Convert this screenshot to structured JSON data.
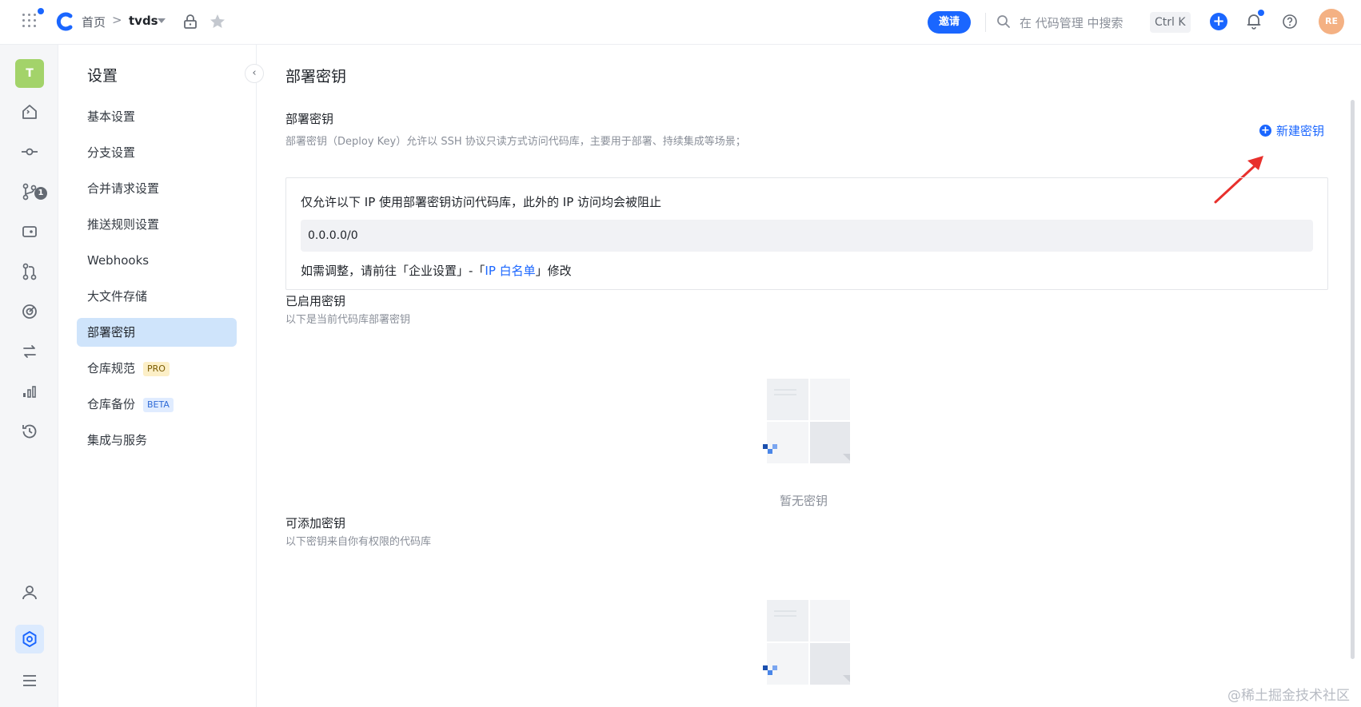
{
  "topbar": {
    "home": "首页",
    "sep": ">",
    "repo": "tvds",
    "invite": "邀请",
    "search_placeholder": "在 代码管理 中搜索",
    "shortcut": "Ctrl K",
    "avatar": "RE"
  },
  "rail": {
    "avatar": "T",
    "badge": "1",
    "icons": [
      "home-icon",
      "commit-icon",
      "branch-icon",
      "tag-icon",
      "merge-request-icon",
      "pipeline-icon",
      "sync-icon",
      "stats-icon",
      "history-icon",
      "user-icon",
      "settings-icon",
      "menu-icon"
    ]
  },
  "nav": {
    "title": "设置",
    "collapse": "‹",
    "items": [
      {
        "label": "基本设置"
      },
      {
        "label": "分支设置"
      },
      {
        "label": "合并请求设置"
      },
      {
        "label": "推送规则设置"
      },
      {
        "label": "Webhooks"
      },
      {
        "label": "大文件存储"
      },
      {
        "label": "部署密钥",
        "active": true
      },
      {
        "label": "仓库规范",
        "tag": "PRO"
      },
      {
        "label": "仓库备份",
        "tag": "BETA"
      },
      {
        "label": "集成与服务"
      }
    ]
  },
  "main": {
    "title": "部署密钥",
    "section_title": "部署密钥",
    "section_desc": "部署密钥（Deploy Key）允许以 SSH 协议只读方式访问代码库，主要用于部署、持续集成等场景；",
    "new_key": "新建密钥",
    "ip_box": {
      "heading": "仅允许以下 IP 使用部署密钥访问代码库，此外的 IP 访问均会被阻止",
      "value": "0.0.0.0/0",
      "note_prefix": "如需调整，请前往「企业设置」-「",
      "note_link": "IP 白名单",
      "note_suffix": "」修改"
    },
    "enabled": {
      "title": "已启用密钥",
      "desc": "以下是当前代码库部署密钥",
      "empty": "暂无密钥"
    },
    "addable": {
      "title": "可添加密钥",
      "desc": "以下密钥来自你有权限的代码库"
    }
  },
  "watermark": "@稀土掘金技术社区",
  "colors": {
    "accent": "#1a66ff",
    "active_nav": "#cfe4fb",
    "arrow": "#e8302c"
  }
}
